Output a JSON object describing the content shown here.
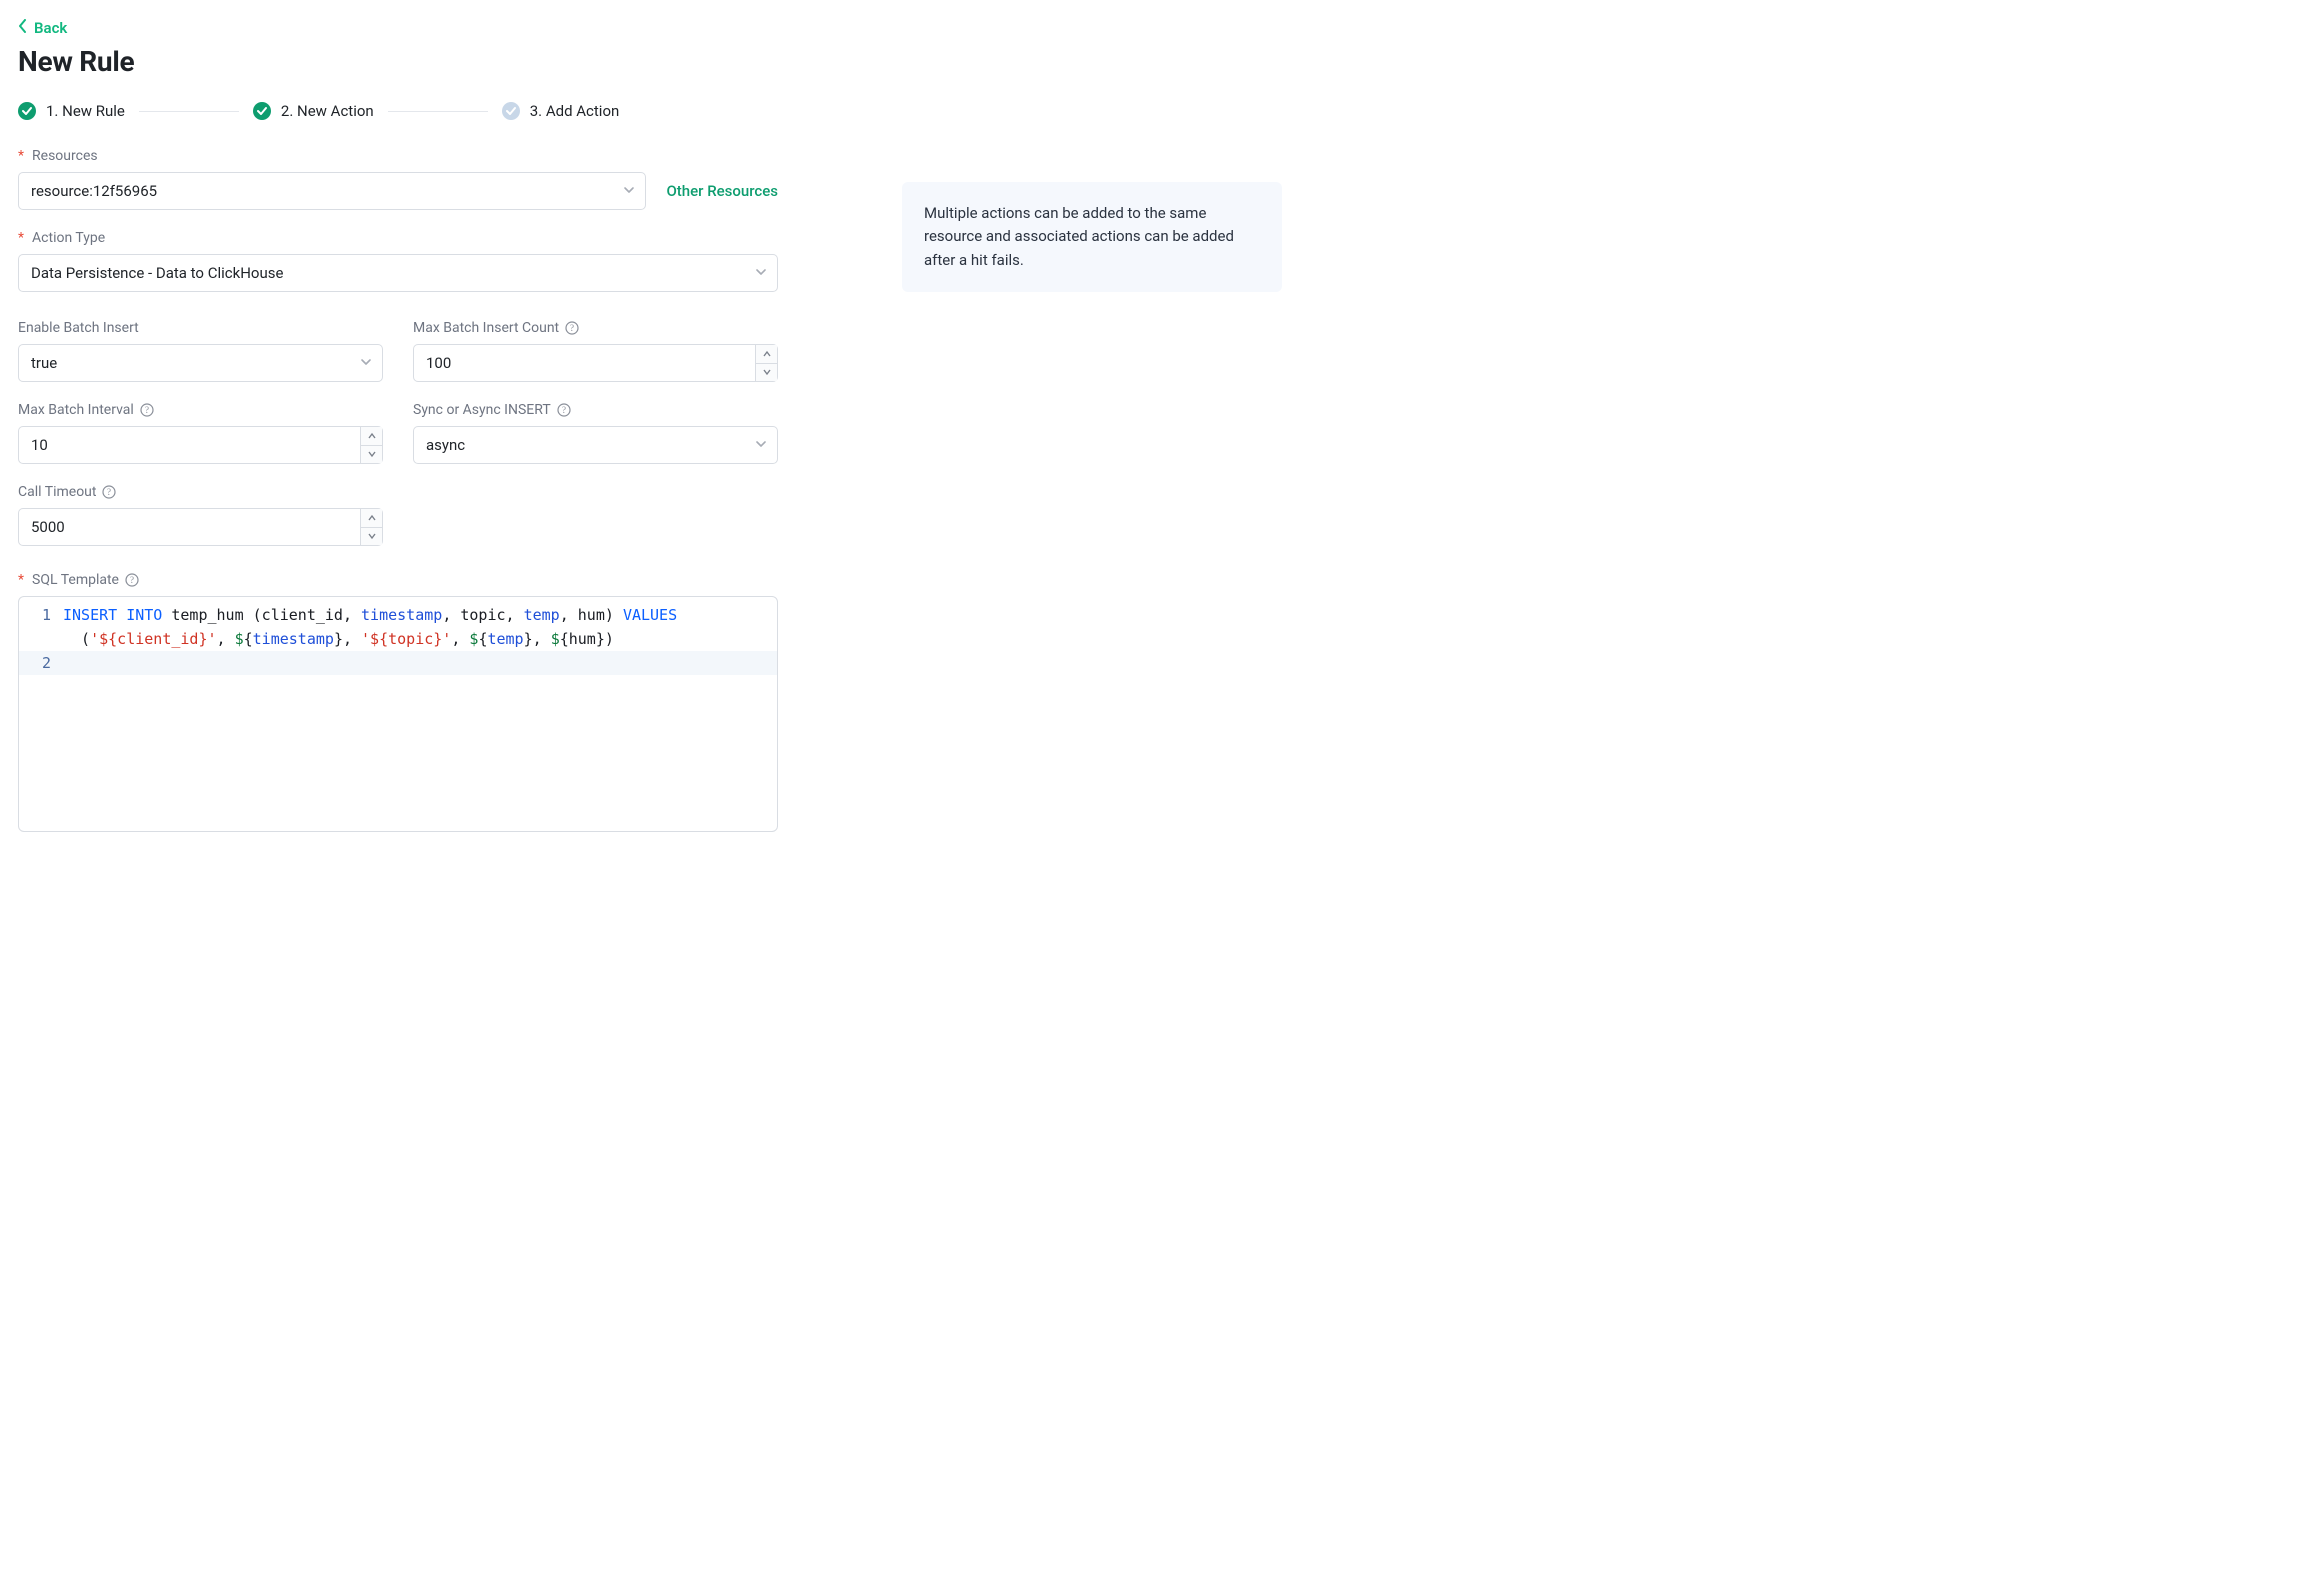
{
  "back_label": "Back",
  "title": "New Rule",
  "steps": [
    {
      "num": "1.",
      "label": "New Rule",
      "state": "done"
    },
    {
      "num": "2.",
      "label": "New Action",
      "state": "done"
    },
    {
      "num": "3.",
      "label": "Add Action",
      "state": "pending"
    }
  ],
  "labels": {
    "resources": "Resources",
    "other_resources": "Other Resources",
    "action_type": "Action Type",
    "enable_batch": "Enable Batch Insert",
    "max_batch_count": "Max Batch Insert Count",
    "max_batch_interval": "Max Batch Interval",
    "sync_async": "Sync or Async INSERT",
    "call_timeout": "Call Timeout",
    "sql_template": "SQL Template"
  },
  "values": {
    "resources": "resource:12f56965",
    "action_type": "Data Persistence - Data to ClickHouse",
    "enable_batch": "true",
    "max_batch_count": "100",
    "max_batch_interval": "10",
    "sync_async": "async",
    "call_timeout": "5000"
  },
  "sql": {
    "line1_tokens": [
      {
        "t": "kw",
        "v": "INSERT INTO"
      },
      {
        "t": "plain",
        "v": " temp_hum (client_id, "
      },
      {
        "t": "id",
        "v": "timestamp"
      },
      {
        "t": "plain",
        "v": ", topic, "
      },
      {
        "t": "id",
        "v": "temp"
      },
      {
        "t": "plain",
        "v": ", hum) "
      },
      {
        "t": "kw",
        "v": "VALUES"
      }
    ],
    "line1b_tokens": [
      {
        "t": "plain",
        "v": "  ("
      },
      {
        "t": "str",
        "v": "'${client_id}'"
      },
      {
        "t": "plain",
        "v": ", "
      },
      {
        "t": "var",
        "v": "$"
      },
      {
        "t": "plain",
        "v": "{"
      },
      {
        "t": "id",
        "v": "timestamp"
      },
      {
        "t": "plain",
        "v": "}, "
      },
      {
        "t": "str",
        "v": "'${topic}'"
      },
      {
        "t": "plain",
        "v": ", "
      },
      {
        "t": "var",
        "v": "$"
      },
      {
        "t": "plain",
        "v": "{"
      },
      {
        "t": "id",
        "v": "temp"
      },
      {
        "t": "plain",
        "v": "}, "
      },
      {
        "t": "var",
        "v": "$"
      },
      {
        "t": "plain",
        "v": "{hum})"
      }
    ],
    "line_numbers": [
      "1",
      "2"
    ],
    "raw": "INSERT INTO temp_hum (client_id, timestamp, topic, temp, hum) VALUES\n  ('${client_id}', ${timestamp}, '${topic}', ${temp}, ${hum})"
  },
  "hint": "Multiple actions can be added to the same resource and associated actions can be added after a hit fails."
}
